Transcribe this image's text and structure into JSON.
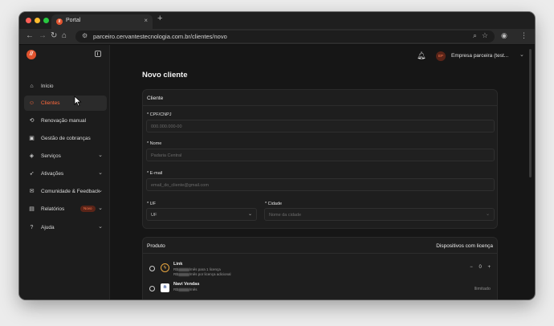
{
  "browser": {
    "tab_title": "Portal",
    "tab_close": "×",
    "new_tab": "+",
    "url": "parceiro.cervantestecnologia.com.br/clientes/novo",
    "colors": {
      "close": "#ff5f57",
      "minimize": "#febc2e",
      "maximize": "#28c840"
    }
  },
  "brand": {
    "logo_text": "//",
    "accent": "#e0532e"
  },
  "sidebar": {
    "items": [
      {
        "label": "Início",
        "icon": "home-icon"
      },
      {
        "label": "Clientes",
        "icon": "users-icon",
        "active": true
      },
      {
        "label": "Renovação manual",
        "icon": "refresh-icon"
      },
      {
        "label": "Gestão de cobranças",
        "icon": "billing-icon"
      },
      {
        "label": "Serviços",
        "icon": "layers-icon",
        "chevron": true
      },
      {
        "label": "Ativações",
        "icon": "rocket-icon",
        "chevron": true
      },
      {
        "label": "Comunidade & Feedback",
        "icon": "chat-icon",
        "chevron": true
      },
      {
        "label": "Relatórios",
        "icon": "report-icon",
        "chevron": true,
        "badge": "Novo"
      },
      {
        "label": "Ajuda",
        "icon": "help-icon",
        "chevron": true
      }
    ]
  },
  "header": {
    "avatar": "EP",
    "company": "Empresa parceira (test..."
  },
  "page": {
    "title": "Novo cliente"
  },
  "client_form": {
    "title": "Cliente",
    "cpf": {
      "label": "* CPF/CNPJ",
      "placeholder": "000.000.000-00"
    },
    "name": {
      "label": "* Nome",
      "placeholder": "Padaria Central"
    },
    "email": {
      "label": "* E-mail",
      "placeholder": "email_do_cliente@gmail.com"
    },
    "uf": {
      "label": "* UF",
      "value": "UF"
    },
    "city": {
      "label": "* Cidade",
      "placeholder": "Nome da cidade"
    }
  },
  "products": {
    "title": "Produto",
    "right_title": "Dispositivos com licença",
    "items": [
      {
        "name": "Link",
        "price_line1_prefix": "R$",
        "price_line1_suffix": "/mês para 1 licença",
        "price_line2_prefix": "R$",
        "price_line2_suffix": "/mês por licença adicional",
        "quantity": "0",
        "minus": "−",
        "plus": "+"
      },
      {
        "name": "Navi Vendas",
        "price_line1_prefix": "R$",
        "price_line1_suffix": "/mês",
        "limit": "Ilimitado"
      }
    ]
  }
}
